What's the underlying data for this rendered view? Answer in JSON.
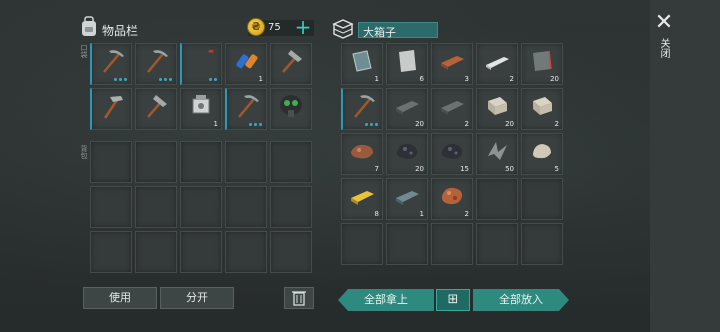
{
  "inventory": {
    "title": "物品栏",
    "coins": "75",
    "pocket_label": "口袋",
    "backpack_label": "背包",
    "pocket_slots": [
      {
        "item": "pickaxe-icon",
        "count": "",
        "dots": 3
      },
      {
        "item": "pickaxe-icon",
        "count": "",
        "dots": 3
      },
      {
        "item": "crowbar-icon",
        "count": "",
        "dots": 2
      },
      {
        "item": "battery-icon",
        "count": "1",
        "dots": 0
      },
      {
        "item": "hammer-icon",
        "count": "",
        "dots": 0
      },
      {
        "item": "pickaxe-steel-icon",
        "count": "",
        "dots": 0
      },
      {
        "item": "hammer-icon",
        "count": "",
        "dots": 0
      },
      {
        "item": "engine-part-icon",
        "count": "1",
        "dots": 0
      },
      {
        "item": "pickaxe-icon",
        "count": "",
        "dots": 3
      },
      {
        "item": "gas-mask-icon",
        "count": "",
        "dots": 0
      }
    ],
    "buttons": {
      "use": "使用",
      "split": "分开"
    }
  },
  "box": {
    "title": "大箱子",
    "slots": [
      {
        "item": "glass-pane-icon",
        "count": "1"
      },
      {
        "item": "metal-sheet-icon",
        "count": "6"
      },
      {
        "item": "copper-ingot-icon",
        "count": "3"
      },
      {
        "item": "nails-icon",
        "count": "2"
      },
      {
        "item": "iron-plate-icon",
        "count": "20"
      },
      {
        "item": "pickaxe-icon",
        "count": "",
        "dots": 3
      },
      {
        "item": "iron-bar-icon",
        "count": "20"
      },
      {
        "item": "iron-bar-icon",
        "count": "2"
      },
      {
        "item": "stone-block-icon",
        "count": "20"
      },
      {
        "item": "stone-block-icon",
        "count": "2"
      },
      {
        "item": "copper-ore-icon",
        "count": "7"
      },
      {
        "item": "coal-icon",
        "count": "20"
      },
      {
        "item": "coal-icon",
        "count": "15"
      },
      {
        "item": "metal-scrap-icon",
        "count": "50"
      },
      {
        "item": "stone-icon",
        "count": "5"
      },
      {
        "item": "gold-ingot-icon",
        "count": "8"
      },
      {
        "item": "steel-bar-icon",
        "count": "1"
      },
      {
        "item": "copper-nugget-icon",
        "count": "2"
      }
    ],
    "buttons": {
      "take_all": "全部拿上",
      "put_all": "全部放入",
      "sort": "⊞"
    }
  },
  "close_label": "关闭",
  "colors": {
    "accent": "#2e8a7e",
    "equip": "#2c9ab4"
  }
}
